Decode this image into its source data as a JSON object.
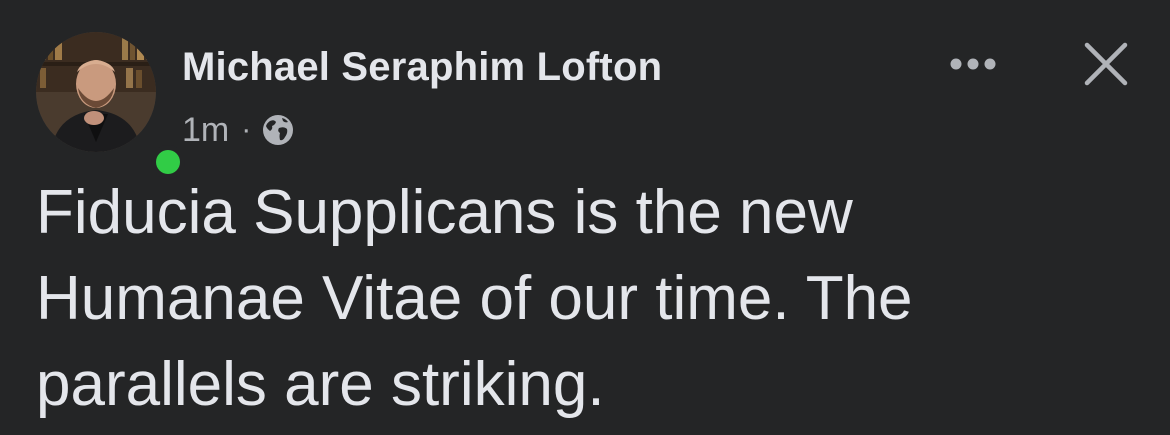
{
  "post": {
    "author_name": "Michael Seraphim Lofton",
    "timestamp": "1m",
    "separator": "·",
    "privacy_icon": "globe-icon",
    "online_status_color": "#31cc46",
    "text": "Fiducia Supplicans is the new Humanae Vitae of our time. The parallels are striking."
  },
  "header": {
    "more_icon": "more-options-icon",
    "close_icon": "close-icon"
  },
  "colors": {
    "background": "#242526",
    "primary_text": "#e4e6eb",
    "secondary_text": "#b0b3b8"
  }
}
